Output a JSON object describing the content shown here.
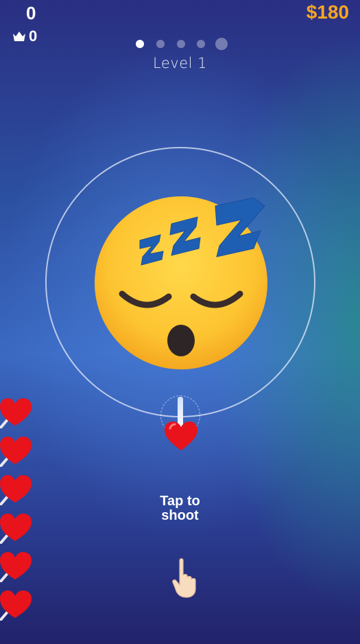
{
  "hud": {
    "score": "0",
    "best_score": "0",
    "money": "$180",
    "level_label": "Level 1",
    "stage_dots": {
      "total": 5,
      "current": 1,
      "last_is_boss": true
    }
  },
  "icons": {
    "crown": "crown-icon",
    "target": "sleeping-face-emoji",
    "projectile": "heart-icon",
    "hint_hand": "pointing-hand-icon"
  },
  "lives": {
    "remaining_hearts": 6
  },
  "hint": {
    "line1": "Tap to",
    "line2": "shoot"
  },
  "colors": {
    "money": "#f5a623",
    "heart": "#e8131b",
    "ring": "#e6ebfa"
  }
}
